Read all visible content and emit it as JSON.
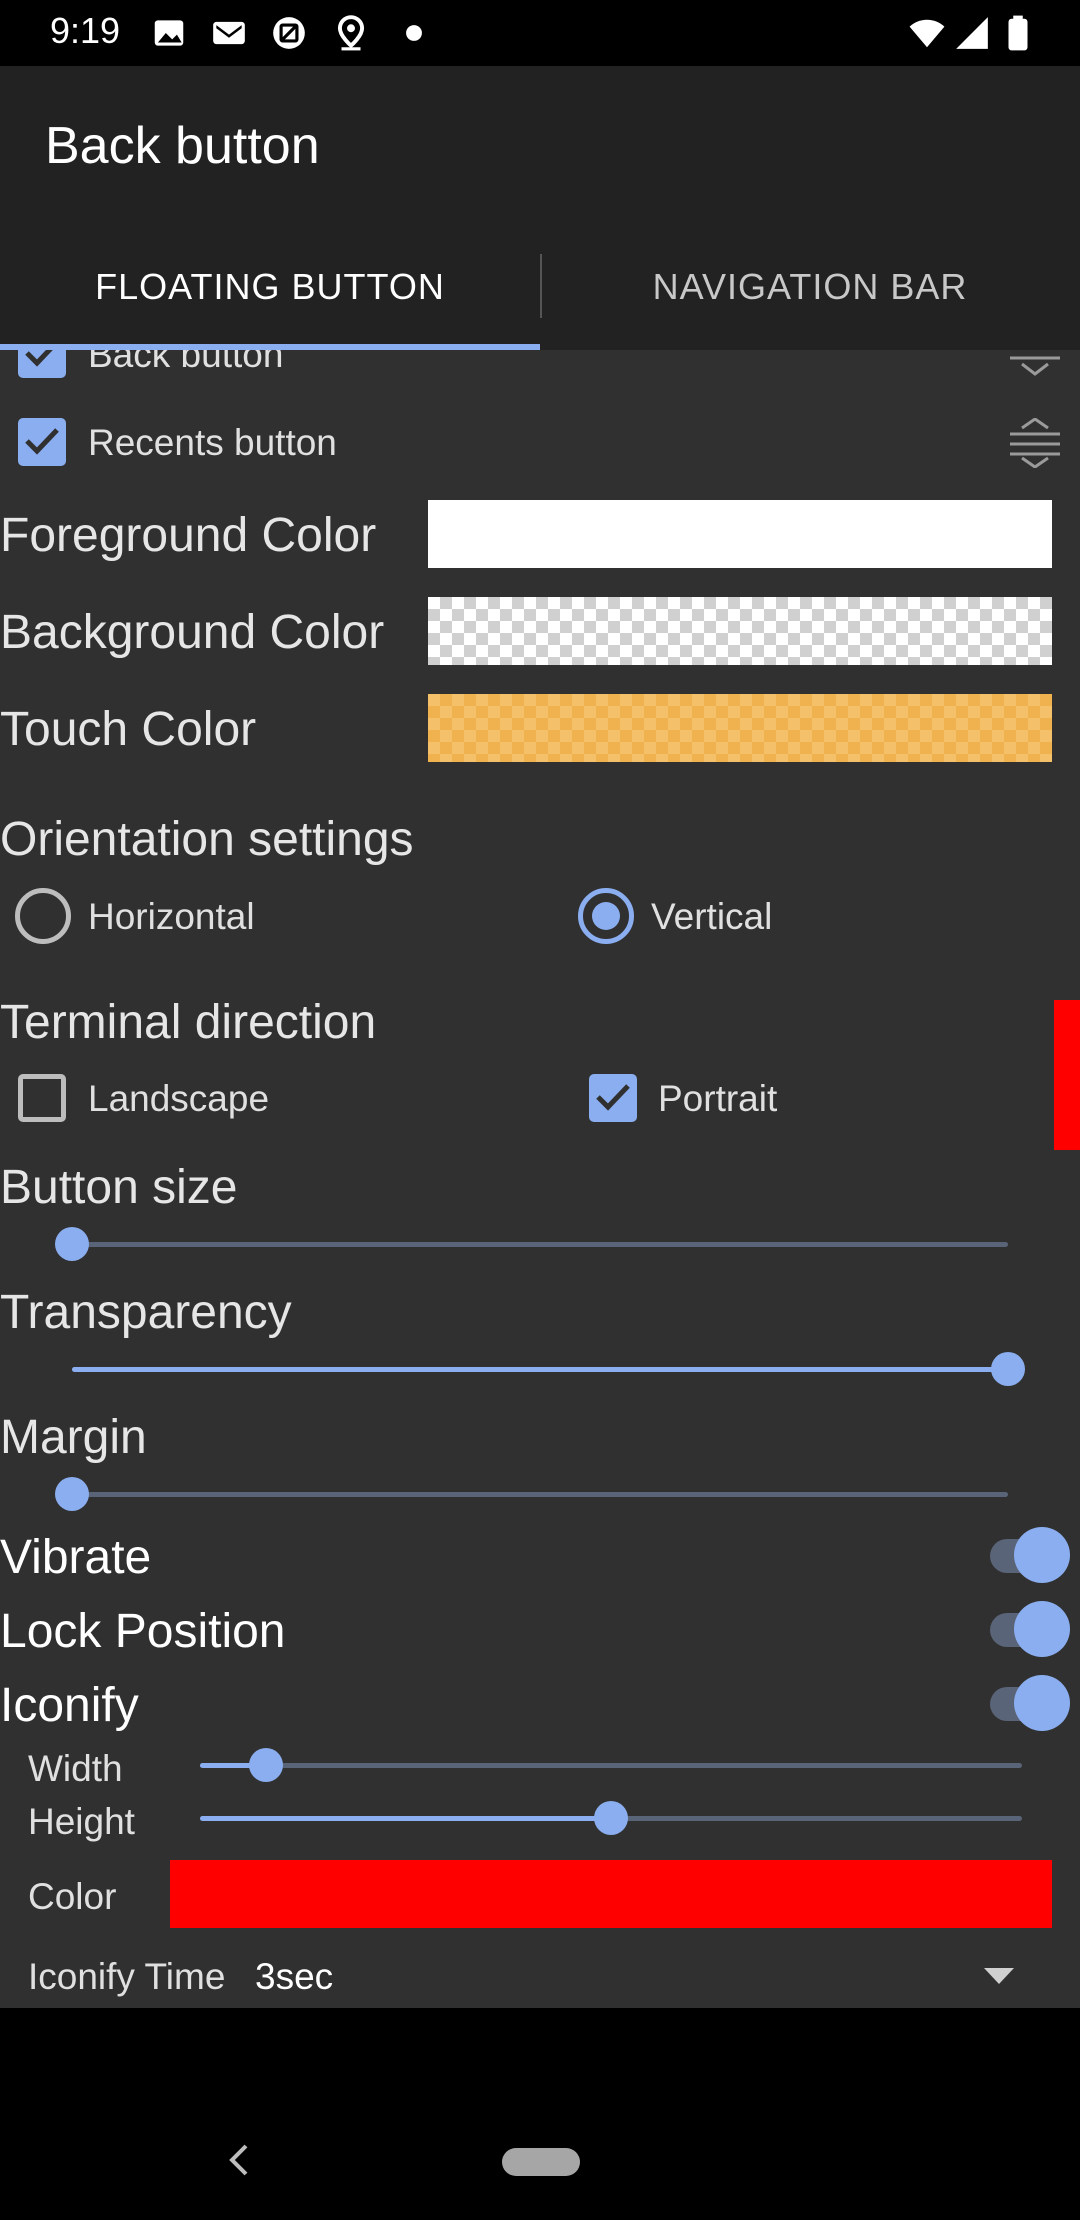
{
  "status": {
    "time": "9:19",
    "icons": [
      "image-icon",
      "gmail-icon",
      "screenshot-icon",
      "location-icon",
      "dot-icon",
      "wifi-icon",
      "signal-icon",
      "battery-icon"
    ]
  },
  "app": {
    "title": "Back button",
    "tabs": [
      {
        "label": "FLOATING BUTTON",
        "selected": true
      },
      {
        "label": "NAVIGATION BAR",
        "selected": false
      }
    ]
  },
  "buttons_list": [
    {
      "label": "Back button",
      "checked": true
    },
    {
      "label": "Recents button",
      "checked": true
    }
  ],
  "colors": {
    "foreground_label": "Foreground Color",
    "background_label": "Background Color",
    "touch_label": "Touch Color",
    "foreground_value": "#ffffff",
    "background_value": "transparent",
    "touch_value": "#f5c06a"
  },
  "orientation": {
    "title": "Orientation settings",
    "options": [
      {
        "label": "Horizontal",
        "selected": false
      },
      {
        "label": "Vertical",
        "selected": true
      }
    ]
  },
  "terminal": {
    "title": "Terminal direction",
    "options": [
      {
        "label": "Landscape",
        "checked": false
      },
      {
        "label": "Portrait",
        "checked": true
      }
    ]
  },
  "sliders": {
    "button_size": {
      "label": "Button size",
      "value": 0.0
    },
    "transparency": {
      "label": "Transparency",
      "value": 1.0
    },
    "margin": {
      "label": "Margin",
      "value": 0.0
    }
  },
  "toggles": {
    "vibrate": {
      "label": "Vibrate",
      "on": true
    },
    "lock_position": {
      "label": "Lock Position",
      "on": true
    },
    "iconify": {
      "label": "Iconify",
      "on": true
    }
  },
  "iconify": {
    "width": {
      "label": "Width",
      "value": 0.08
    },
    "height": {
      "label": "Height",
      "value": 0.5
    },
    "color_label": "Color",
    "color_value": "#ff0000",
    "time_label": "Iconify Time",
    "time_value": "3sec"
  },
  "accent": "#8aaef0"
}
